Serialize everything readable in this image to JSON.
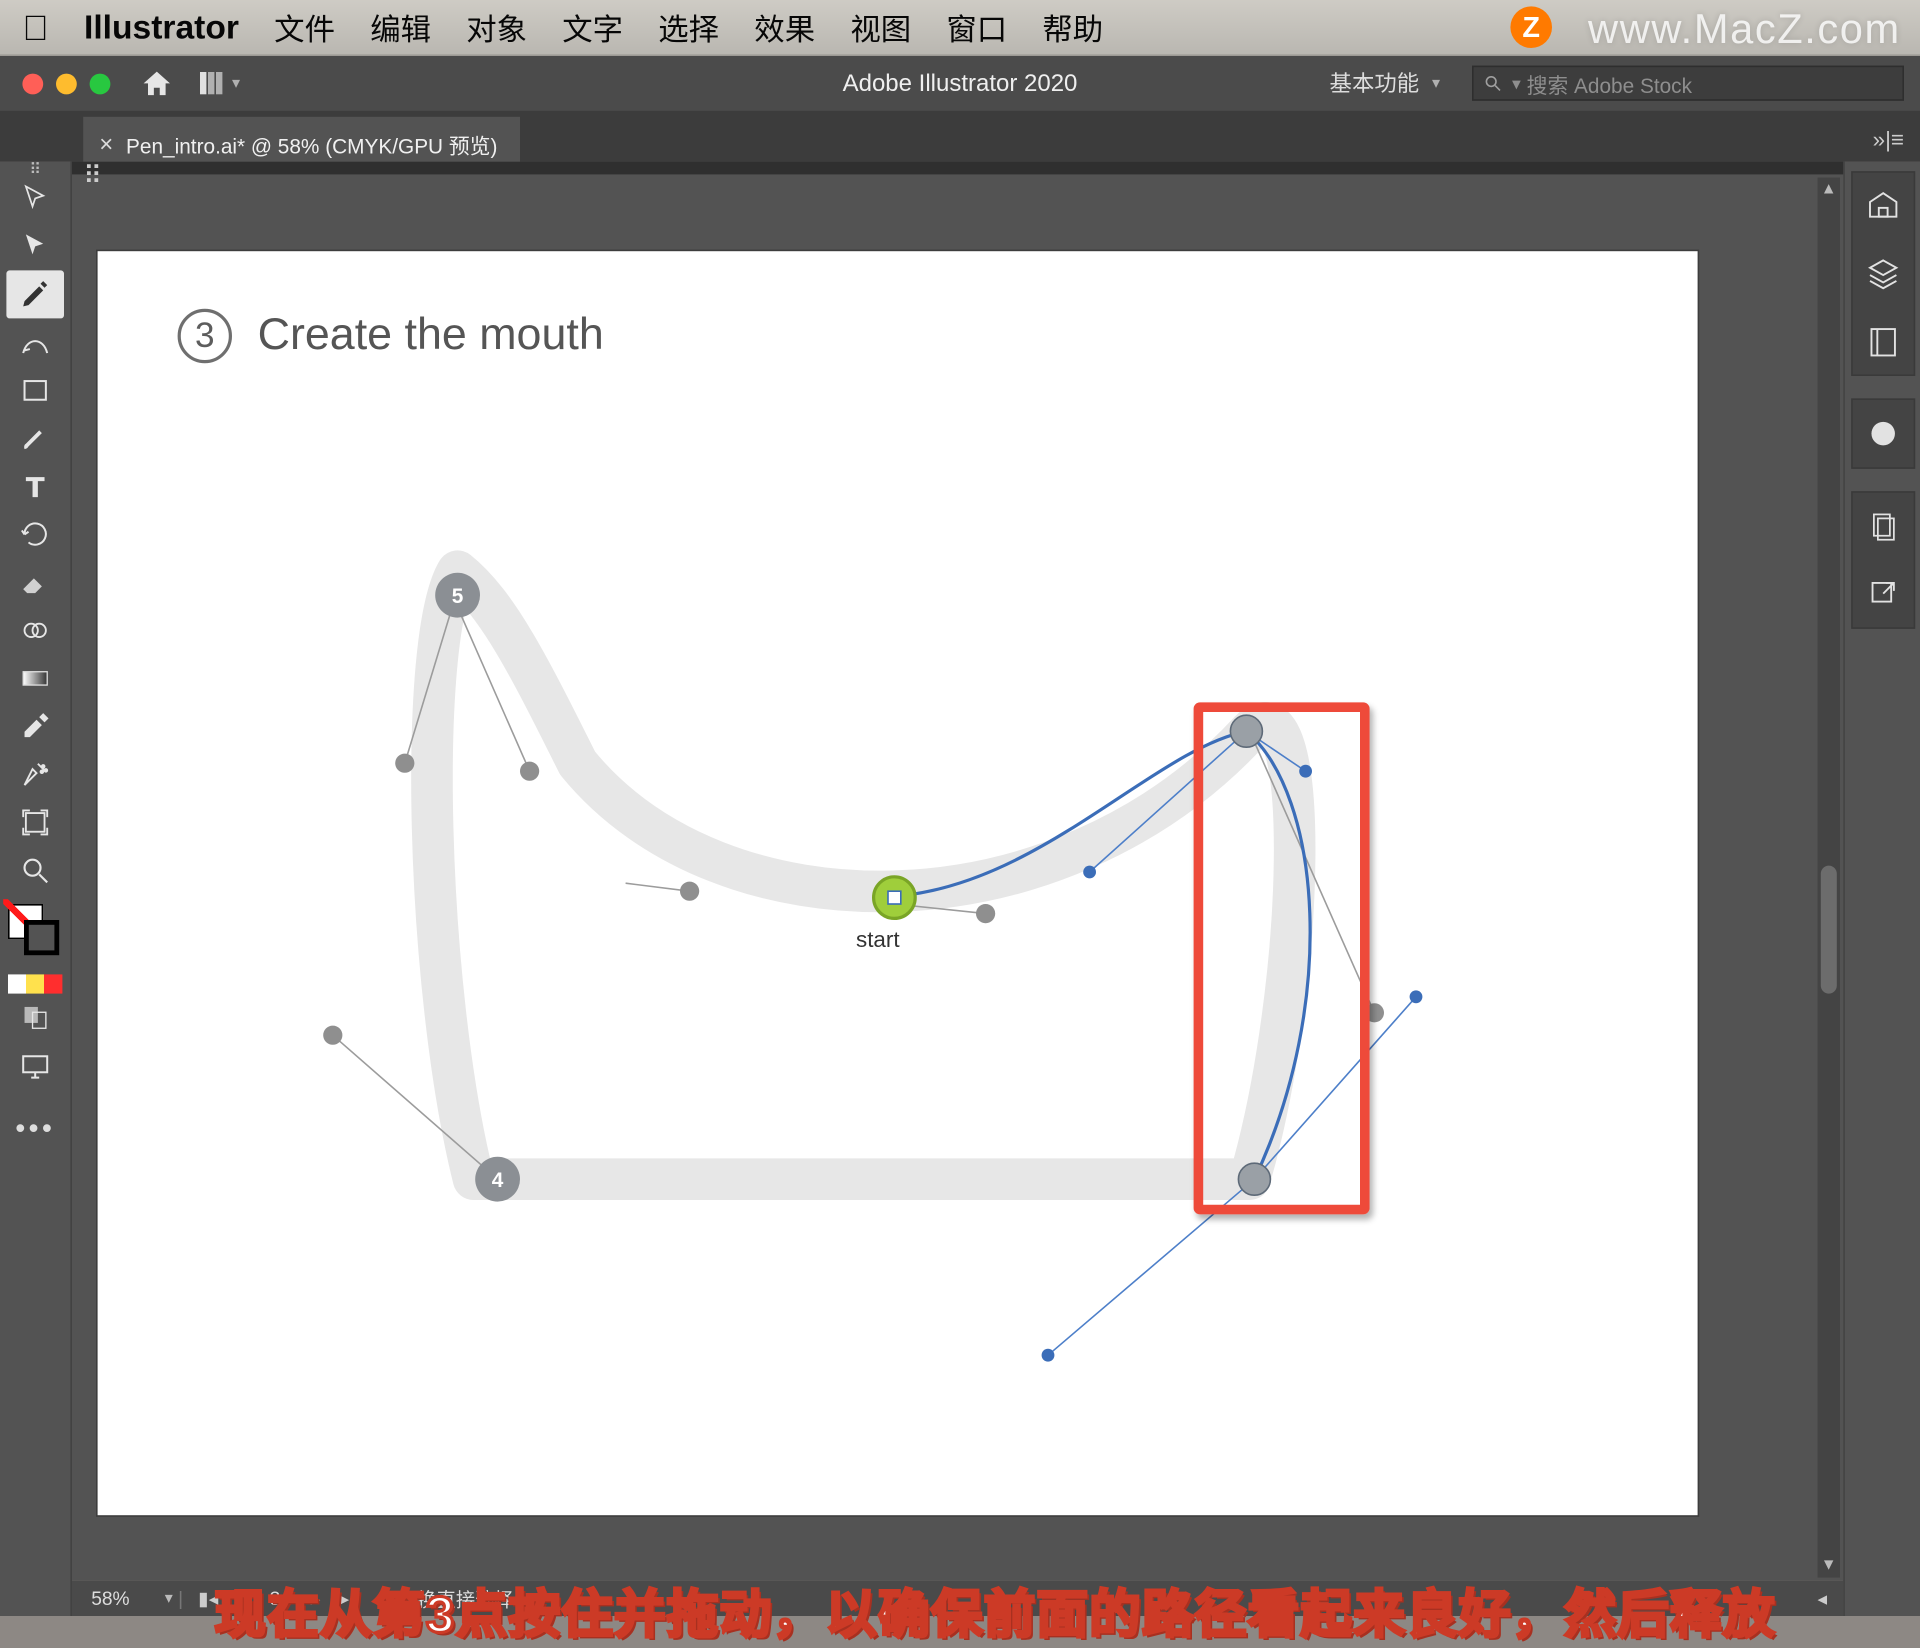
{
  "menubar": {
    "app_name": "Illustrator",
    "items": [
      "文件",
      "编辑",
      "对象",
      "文字",
      "选择",
      "效果",
      "视图",
      "窗口",
      "帮助"
    ]
  },
  "watermark": {
    "badge": "Z",
    "text": "www.MacZ.com"
  },
  "appbar": {
    "title": "Adobe Illustrator 2020",
    "workspace": "基本功能",
    "search_placeholder": "搜索 Adobe Stock"
  },
  "doc_tab": {
    "label": "Pen_intro.ai* @ 58% (CMYK/GPU 预览)"
  },
  "canvas": {
    "step_number": "3",
    "step_title": "Create the mouth",
    "start_label": "start",
    "point_badges": {
      "p4": "4",
      "p5": "5"
    }
  },
  "narration": "现在从第3点按住并拖动，以确保前面的路径看起来良好，然后释放",
  "statusbar": {
    "zoom": "58%",
    "artboard": "3",
    "mode": "切换直接选择"
  }
}
